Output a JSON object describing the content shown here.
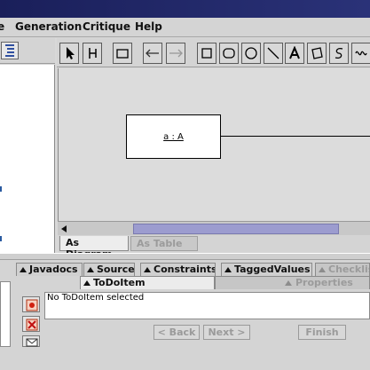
{
  "menu": {
    "generation": "Generation",
    "critique": "Critique",
    "help": "Help"
  },
  "diagram": {
    "class_label": "a : A"
  },
  "diagram_tabs": {
    "as_diagram": "As Diagram",
    "as_table": "As Table"
  },
  "details_tabs": {
    "javadocs": "Javadocs",
    "source": "Source",
    "constraints": "Constraints",
    "tagged_values": "TaggedValues",
    "checklist": "Checklist",
    "todo_item": "ToDoItem",
    "properties": "Properties"
  },
  "todo": {
    "message": "No ToDoItem selected"
  },
  "wizard": {
    "back": "< Back",
    "next": "Next >",
    "finish": "Finish"
  }
}
